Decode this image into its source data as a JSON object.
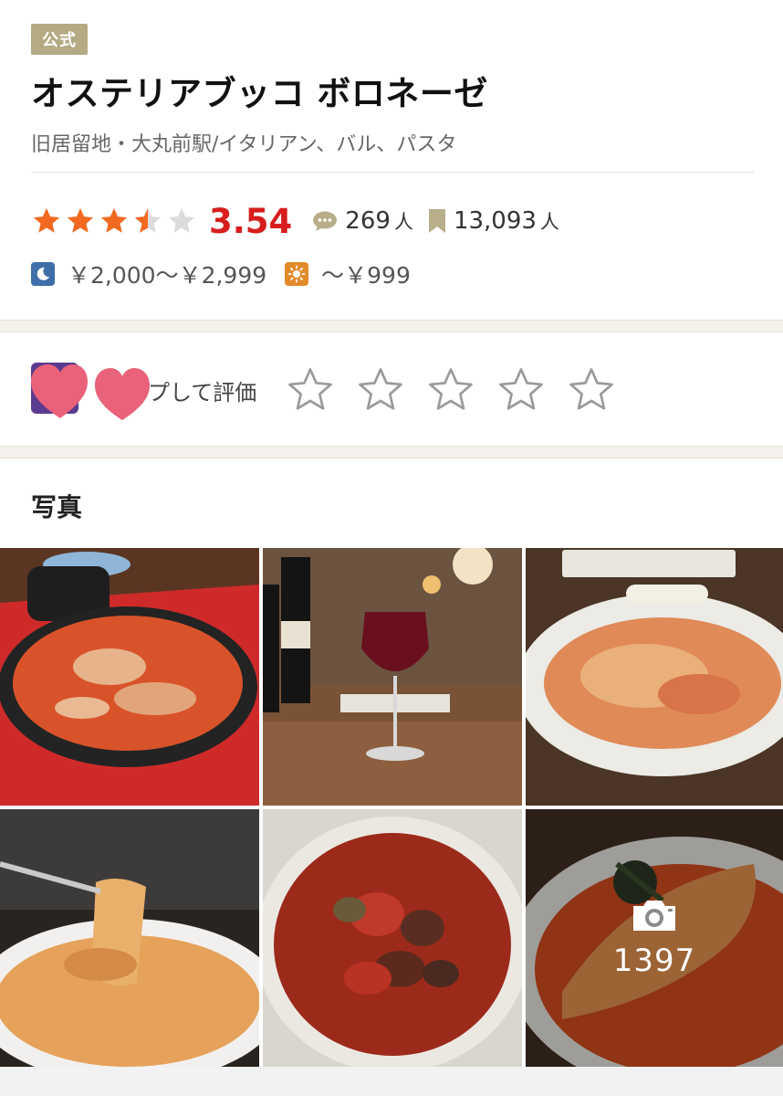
{
  "restaurant": {
    "badge": "公式",
    "name": "オステリアブッコ ボロネーゼ",
    "subtitle": "旧居留地・大丸前駅/イタリアン、バル、パスタ"
  },
  "rating": {
    "score": "3.54",
    "stars_value": 3.5,
    "reviews_count": "269",
    "reviews_unit": "人",
    "saved_count": "13,093",
    "saved_unit": "人",
    "star_color": "#f26a21"
  },
  "price": {
    "dinner": "￥2,000～￥2,999",
    "lunch": "～￥999"
  },
  "review_prompt": {
    "label": "プして評価",
    "star_count": 5
  },
  "photos": {
    "title": "写真",
    "count": "1397"
  },
  "icons": {
    "dinner": "moon-icon",
    "lunch": "sun-icon",
    "reviews": "speech-bubble-icon",
    "saved": "bookmark-icon",
    "camera": "camera-icon"
  }
}
